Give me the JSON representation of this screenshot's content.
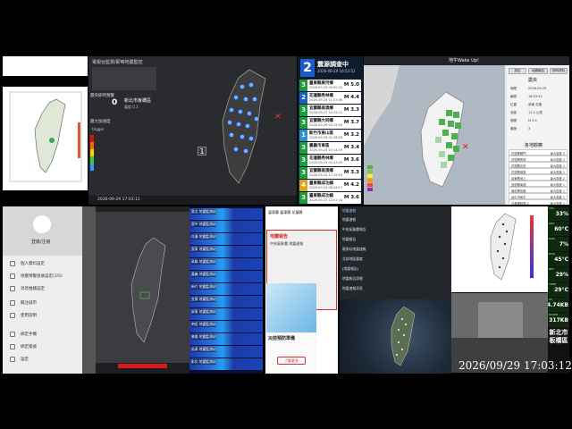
{
  "dark_monitor": {
    "title": "電視台監測/即時地震監控",
    "epicenter_label": "震央即時預警",
    "epicenter_value": "0",
    "epicenter_place": "新北市板橋區",
    "epicenter_sub": "震度 0.1",
    "max_label": "最大加速度",
    "max_value": "trigger",
    "intensity_value": "1",
    "footer_time": "2026-09-29 17:03:11"
  },
  "quake_list": {
    "count": "2",
    "title": "震源調查中",
    "time": "2026-09-29 16:53:52",
    "rows": [
      {
        "int": "3",
        "place": "臺東縣東河鄉",
        "time": "2026-09-29 09:50:20",
        "mag": "M 5.0",
        "color": "#1c9c3a"
      },
      {
        "int": "2",
        "place": "花蓮縣秀林鄉",
        "time": "2026-09-28 11:03:06",
        "mag": "M 4.4",
        "color": "#1c5cc9"
      },
      {
        "int": "3",
        "place": "宜蘭縣南澳鄉",
        "time": "2026-09-27 15:45:12",
        "mag": "M 3.3",
        "color": "#1c9c3a"
      },
      {
        "int": "3",
        "place": "宜蘭縣大同鄉",
        "time": "2026-09-26 04:15:00",
        "mag": "M 3.7",
        "color": "#1c9c3a"
      },
      {
        "int": "1",
        "place": "新竹市東山區",
        "time": "2026-09-26 01:38:28",
        "mag": "M 3.2",
        "color": "#2f8ed1"
      },
      {
        "int": "3",
        "place": "嘉義市東區",
        "time": "2026-09-25 20:14:19",
        "mag": "M 3.4",
        "color": "#1c9c3a"
      },
      {
        "int": "3",
        "place": "花蓮縣秀林鄉",
        "time": "2026-09-25 02:43:00",
        "mag": "M 3.6",
        "color": "#1c9c3a"
      },
      {
        "int": "3",
        "place": "宜蘭縣南澳鄉",
        "time": "2026-09-24 17:16:03",
        "mag": "M 3.3",
        "color": "#1c9c3a"
      },
      {
        "int": "4",
        "place": "臺東縣成功鎮",
        "time": "2026-09-24 08:28:17",
        "mag": "M 4.2",
        "color": "#e3a21a"
      },
      {
        "int": "3",
        "place": "臺東縣成功鎮",
        "time": "2026-09-23 22:07:44",
        "mag": "M 3.6",
        "color": "#1c9c3a"
      }
    ]
  },
  "app": {
    "title": "地牛Wake Up!",
    "buttons": [
      "設定",
      "地震報告",
      "即時資料"
    ],
    "side_title": "震央",
    "info": [
      {
        "k": "時間",
        "v": "2026-09-29"
      },
      {
        "k": "編號",
        "v": "16:53:52"
      },
      {
        "k": "位置",
        "v": "臺東 花蓮"
      },
      {
        "k": "深度",
        "v": "11.5 公里"
      },
      {
        "k": "規模",
        "v": "M 3.4"
      },
      {
        "k": "震度",
        "v": "3"
      }
    ],
    "side_head2": "各地觀察",
    "rows": [
      {
        "l": "花蓮縣銅門",
        "r": "最大震度 3"
      },
      {
        "l": "花蓮縣秀林",
        "r": "最大震度 2"
      },
      {
        "l": "花蓮縣吉安",
        "r": "最大震度 2"
      },
      {
        "l": "花蓮縣萬榮",
        "r": "最大震度 2"
      },
      {
        "l": "臺東縣池上",
        "r": "最大震度 2"
      },
      {
        "l": "宜蘭縣南澳",
        "r": "最大震度 1"
      },
      {
        "l": "南投縣信義",
        "r": "最大震度 1"
      },
      {
        "l": "臺中市和平",
        "r": "最大震度 1"
      },
      {
        "l": "嘉義縣阿里山",
        "r": "最大震度 1"
      },
      {
        "l": "高雄市桃源",
        "r": "最大震度 1"
      }
    ]
  },
  "sidebar": {
    "login": "登錄/注冊",
    "items": [
      "個人資料設定",
      "地震預警接收設定(3/5)",
      "消息推播設定",
      "關注城市",
      "使用說明",
      "綁定手機",
      "綁定帳號",
      "設定"
    ]
  },
  "spectrum": {
    "labels": [
      "臺北 地震監測站",
      "臺中 地震監測站",
      "花蓮 地震監測站",
      "臺東 地震監測站",
      "高雄 地震監測站",
      "嘉義 地震監測站",
      "新竹 地震監測站",
      "宜蘭 地震監測站",
      "屏東 地震監測站",
      "南投 地震監測站",
      "基隆 地震監測站",
      "苗栗 地震監測站",
      "彰化 地震監測站"
    ]
  },
  "news": {
    "head": "臺東縣 臺東縣 花蓮縣",
    "alert_title": "地震報告",
    "alert_body": "中央氣象署 地震速報",
    "ad_title": "災前預防準備",
    "ad_button": "了解更多"
  },
  "chat": {
    "header": "地震速報",
    "messages": [
      "地震速報",
      "中央氣象署報告",
      "地震報告",
      "觀測站地震速報",
      "北部地區震度",
      "[地震報告]",
      "地震報告詳細",
      "地震速報消息"
    ]
  },
  "stats": [
    {
      "l": "CPU",
      "n": "33%"
    },
    {
      "l": "GPU",
      "n": "60°C"
    },
    {
      "l": "RAM",
      "n": "7%"
    },
    {
      "l": "DISK",
      "n": "45°C"
    },
    {
      "l": "NET",
      "n": "29%"
    },
    {
      "l": "TEMP",
      "n": "29°C"
    },
    {
      "l": "UP",
      "n": "4.74KB"
    },
    {
      "l": "DOWN",
      "n": "317KB"
    }
  ],
  "clock": "2026/09/29 17:03:12",
  "region": "新北市板橋區"
}
